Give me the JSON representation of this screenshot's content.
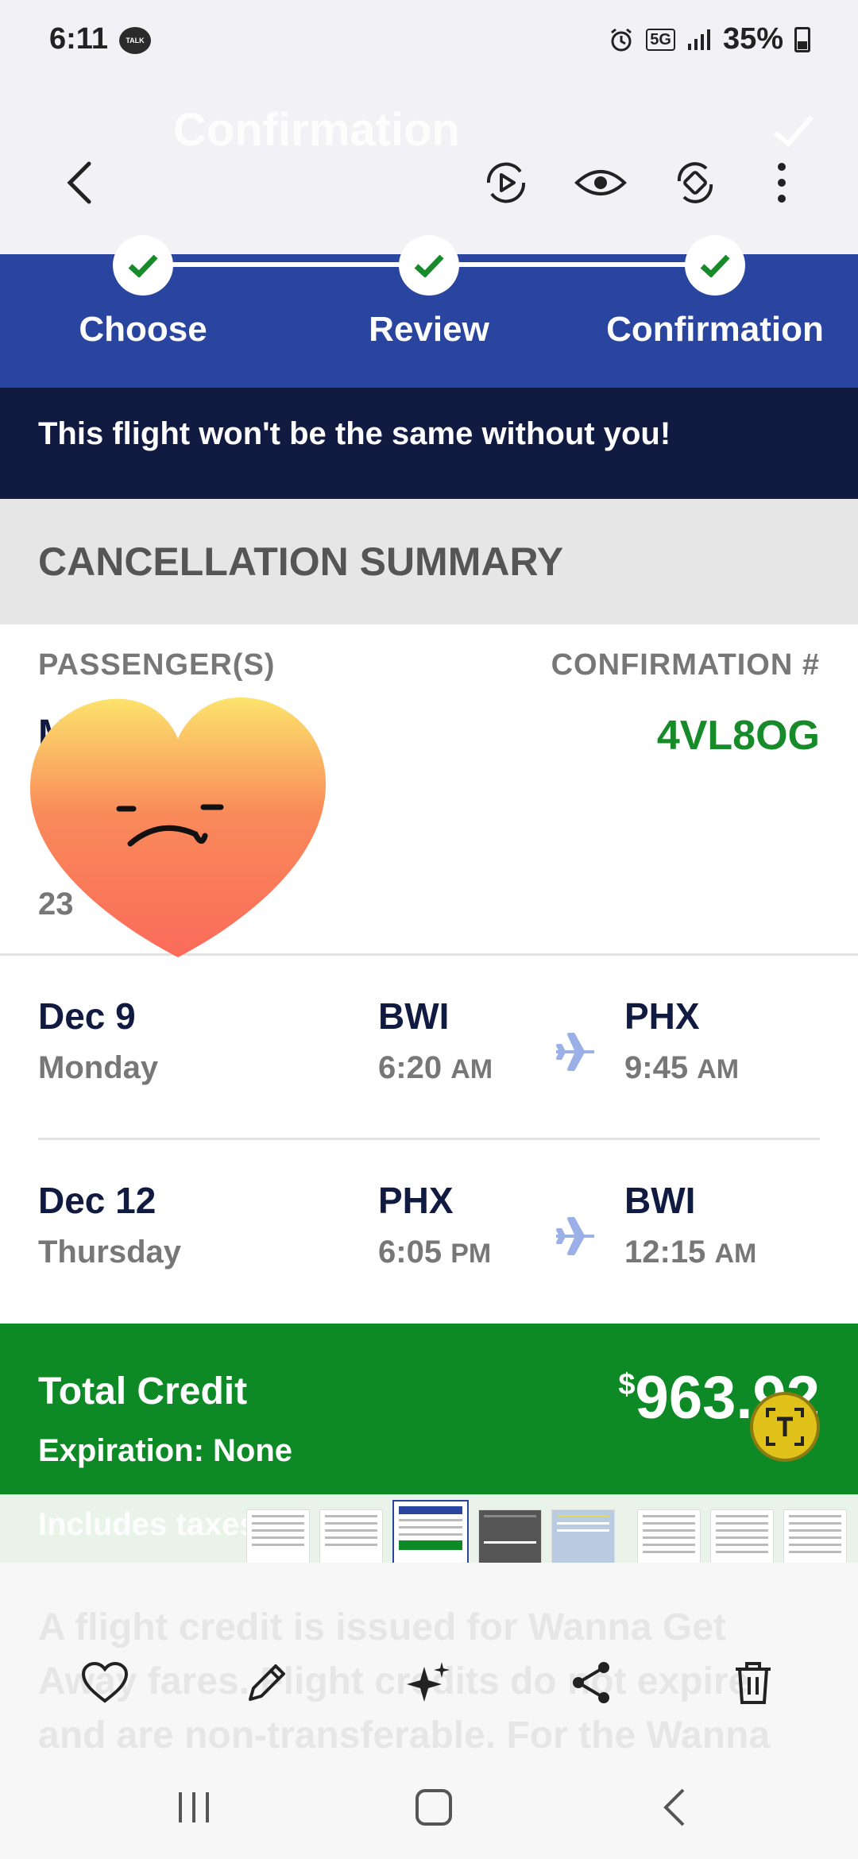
{
  "status_bar": {
    "time": "6:11",
    "talk_badge": "TALK",
    "network": "5G",
    "battery": "35%"
  },
  "viewer": {
    "ghost_title": "Confirmation"
  },
  "progress": {
    "steps": [
      {
        "label": "Choose",
        "done": true
      },
      {
        "label": "Review",
        "done": true
      },
      {
        "label": "Confirmation",
        "done": true
      }
    ]
  },
  "banner": {
    "text": "This flight won't be the same without you!"
  },
  "summary": {
    "heading": "CANCELLATION SUMMARY"
  },
  "passenger": {
    "header": "PASSENGER(S)",
    "name_partial": "M     un",
    "number_partial": "23"
  },
  "confirmation": {
    "header": "CONFIRMATION #",
    "code": "4VL8OG"
  },
  "flights": [
    {
      "date": "Dec 9",
      "day": "Monday",
      "from": "BWI",
      "depart": "6:20",
      "depart_ampm": "AM",
      "to": "PHX",
      "arrive": "9:45",
      "arrive_ampm": "AM"
    },
    {
      "date": "Dec 12",
      "day": "Thursday",
      "from": "PHX",
      "depart": "6:05",
      "depart_ampm": "PM",
      "to": "BWI",
      "arrive": "12:15",
      "arrive_ampm": "AM"
    }
  ],
  "credit": {
    "title": "Total Credit",
    "expiration": "Expiration: None",
    "currency": "$",
    "amount": "963.92"
  },
  "taxes": {
    "text": "Includes taxes"
  },
  "bottom_ghost": {
    "text": "A flight credit is issued for Wanna Get Away fares. Flight credits do not expire and are non-transferable. For the Wanna"
  },
  "colors": {
    "brand_blue": "#2945a0",
    "navy": "#111b41",
    "green": "#0d8a25"
  },
  "icons": {
    "toolbar": [
      "back-icon",
      "remaster-icon",
      "eye-icon",
      "rotate-icon",
      "more-icon"
    ],
    "actions": [
      "heart-icon",
      "edit-icon",
      "sparkle-icon",
      "share-icon",
      "trash-icon"
    ],
    "nav": [
      "recents-icon",
      "home-icon",
      "nav-back-icon"
    ]
  }
}
